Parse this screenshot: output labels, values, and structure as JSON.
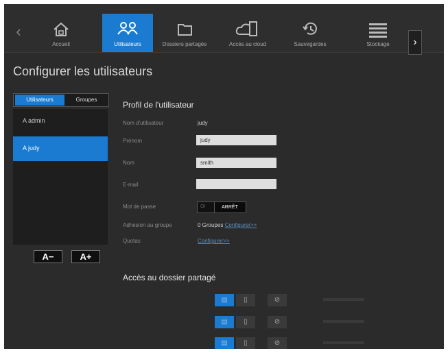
{
  "nav": {
    "items": [
      {
        "label": "Accueil",
        "icon": "home-icon"
      },
      {
        "label": "Utilisateurs",
        "icon": "users-icon"
      },
      {
        "label": "Dossiers partagés",
        "icon": "folder-icon"
      },
      {
        "label": "Accès au cloud",
        "icon": "cloud-device-icon"
      },
      {
        "label": "Sauvegardes",
        "icon": "history-icon"
      },
      {
        "label": "Stockage",
        "icon": "storage-icon"
      }
    ],
    "prev_glyph": "‹",
    "next_glyph": "›",
    "active_index": 1,
    "accent_color": "#1a7bd1"
  },
  "page": {
    "title": "Configurer les utilisateurs"
  },
  "left": {
    "tabs": [
      "Utilisateurs",
      "Groupes"
    ],
    "users": [
      "admin",
      "judy"
    ],
    "remove_glyph": "A−",
    "add_glyph": "A+"
  },
  "profile": {
    "title": "Profil de l'utilisateur",
    "username_label": "Nom d'utilisateur",
    "username_value": "judy",
    "firstname_label": "Prénom",
    "firstname_value": "judy",
    "lastname_label": "Nom",
    "lastname_value": "smith",
    "email_label": "E-mail",
    "email_value": "",
    "password_label": "Mot de passe",
    "password_on": "OI",
    "password_off": "ARRÊT",
    "groups_label": "Adhésion au groupe",
    "groups_value": "0 Groupes",
    "groups_link": "Configurer>>",
    "quotas_label": "Quotas",
    "quotas_link": "Configurer>>"
  },
  "shares": {
    "title": "Accès au dossier partagé"
  }
}
